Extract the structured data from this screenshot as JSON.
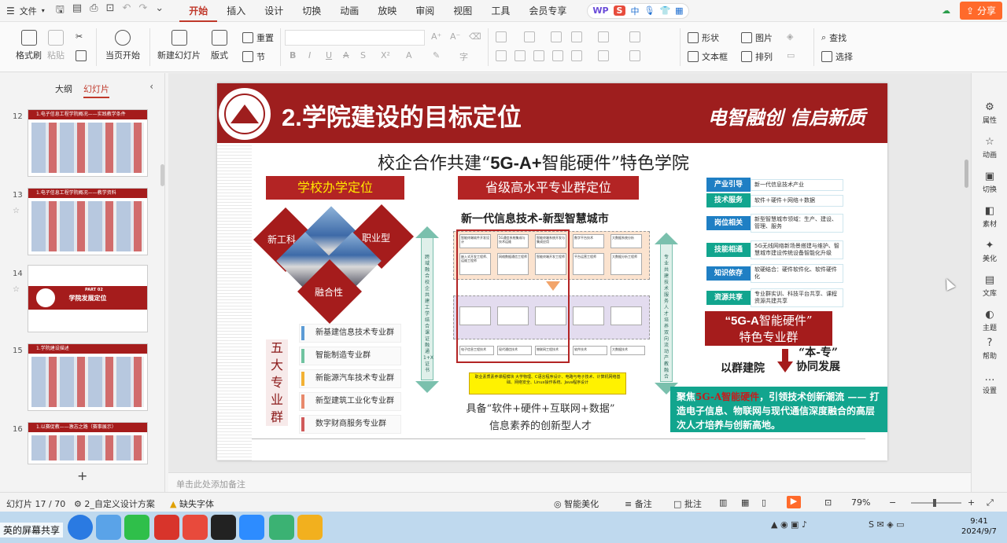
{
  "menubar": {
    "file": "文件",
    "tabs": [
      "开始",
      "插入",
      "设计",
      "切换",
      "动画",
      "放映",
      "审阅",
      "视图",
      "工具",
      "会员专享"
    ],
    "active_tab": "开始",
    "wps_label": "WP",
    "wps_s": "S",
    "wps_zh": "中",
    "share": "分享"
  },
  "ribbon": {
    "format_painter": "格式刷",
    "paste": "粘贴",
    "from_current": "当页开始",
    "new_slide": "新建幻灯片",
    "layout": "版式",
    "reset": "重置",
    "section": "节",
    "shape": "形状",
    "picture": "图片",
    "find": "查找",
    "textbox": "文本框",
    "arrange": "排列",
    "select": "选择",
    "font_size_a_up": "A⁺",
    "font_size_a_down": "A⁻"
  },
  "leftpanel": {
    "tab_outline": "大纲",
    "tab_slides": "幻灯片",
    "thumbs": [
      {
        "num": "12",
        "title": "1.电子信息工程学院概况——实践教学条件"
      },
      {
        "num": "13",
        "title": "1.电子信息工程学院概况——教学资料"
      },
      {
        "num": "14",
        "title": "学院发展定位",
        "header": "PART 02"
      },
      {
        "num": "15",
        "title": "1.学院建设描述"
      },
      {
        "num": "16",
        "title": "1.以赛促教——激志之路（赛事展示）"
      }
    ]
  },
  "slide": {
    "title": "2.学院建设的目标定位",
    "slogan": "电智融创  信启新质",
    "subtitle_pre": "校企合作共建“",
    "subtitle_em": "5G-A+",
    "subtitle_post": "智能硬件”特色学院",
    "school_label": "学校办学定位",
    "d_new_eng": "新工科",
    "d_career": "职业型",
    "d_fusion": "融合性",
    "wuda": "五大专业群",
    "groups": [
      {
        "name": "新基建信息技术专业群",
        "color": "#5b9bd5"
      },
      {
        "name": "智能制造专业群",
        "color": "#70c3a0"
      },
      {
        "name": "新能源汽车技术专业群",
        "color": "#f2b134"
      },
      {
        "name": "新型建筑工业化专业群",
        "color": "#e8896b"
      },
      {
        "name": "数字财商服务专业群",
        "color": "#d05a5a"
      }
    ],
    "province_label": "省级高水平专业群定位",
    "center_caption": "新一代信息技术-新型智慧城市",
    "left_arrow_text": "跨域融合 校企共建 工学结合 课证融通 1+X 证书",
    "right_arrow_text": "专业共建 技术服务 人才培养 双向流动 产教融合",
    "diagram_top": [
      "智能终端软件开发设计",
      "5G通信系统集成与技术运维",
      "智能终端系统开发与集成应用",
      "数字平台技术",
      "大数据系统分析"
    ],
    "diagram_mid": [
      "嵌入式开发工程师、运维工程师",
      "网络数据通信工程师",
      "智能终端开发工程师",
      "平台运营工程师",
      "大数据分析工程师"
    ],
    "diagram_bottom": [
      "电子信息工程技术",
      "现代通信技术",
      "物联网工程技术",
      "软件技术",
      "大数据技术"
    ],
    "yellow_box": "职业素质素养课程模块 大学物理、C语言程序设计、电路与电子技术、计算机网络基础、网络安全、Linux操作系统、Java程序设计",
    "talent_line1": "具备“软件+硬件+互联网+数据”",
    "talent_line2": "信息素养的创新型人才",
    "right_rows": [
      {
        "tag": "产业引导",
        "text": "新一代信息技术产业",
        "color": "#1f7fc4"
      },
      {
        "tag": "技术服务",
        "text": "软件＋硬件＋网络＋数据",
        "color": "#12a58e"
      },
      {
        "tag": "岗位相关",
        "text": "新型智慧城市领域：生产、建设、管理、服务",
        "color": "#1f7fc4"
      },
      {
        "tag": "技能相通",
        "text": "5G无线网络新场景搭建与维护、智慧城市建设传统设备智能化升级",
        "color": "#12a58e"
      },
      {
        "tag": "知识依存",
        "text": "软硬结合：硬件软件化、软件硬件化",
        "color": "#1f7fc4"
      },
      {
        "tag": "资源共享",
        "text": "专业群实训、科技平台共享、课程资源共建共享",
        "color": "#12a58e"
      }
    ],
    "fg_line1_em": "“5G-A",
    "fg_line1_rest": "智能硬件”",
    "fg_line2": "特色专业群",
    "ben_line1": "“本-专”",
    "ben_line2": "协同发展",
    "qunjian": "以群建院",
    "teal_pre": "聚焦",
    "teal_hl": "5G-A智能硬件",
    "teal_post": "，引领技术创新潮流 —— 打造电子信息、物联网与现代通信深度融合的高层次人才培养与创新高地。"
  },
  "notes_placeholder": "单击此处添加备注",
  "rightbar": [
    "属性",
    "动画",
    "切换",
    "素材",
    "美化",
    "文库",
    "主题",
    "帮助",
    "设置"
  ],
  "status": {
    "slide_pos": "幻灯片 17 / 70",
    "design": "2_自定义设计方案",
    "missing_font": "缺失字体",
    "beautify": "智能美化",
    "notes": "备注",
    "comments": "批注",
    "zoom": "79%"
  },
  "taskbar": {
    "share_label": "英的屏幕共享",
    "time": "9:41",
    "date": "2024/9/7"
  }
}
